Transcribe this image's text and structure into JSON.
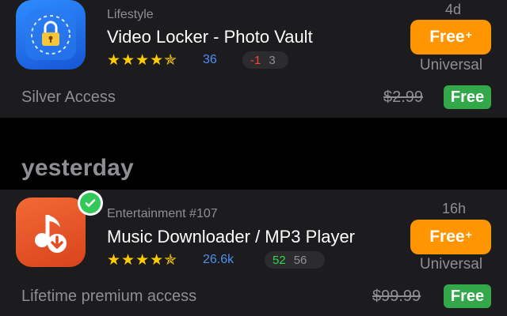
{
  "apps": [
    {
      "category": "Lifestyle",
      "title": "Video Locker - Photo Vault",
      "stars": "★★★★✯",
      "rating_count": "36",
      "rank_change": "-1",
      "rank": "3",
      "time_ago": "4d",
      "button_label": "Free",
      "button_plus": "+",
      "platform": "Universal",
      "access": "Silver Access",
      "old_price": "$2.99",
      "price": "Free",
      "icon": "lock-vault-icon",
      "icon_color": "#2f8cff"
    },
    {
      "category": "Entertainment #107",
      "title": "Music Downloader / MP3 Player",
      "stars": "★★★★✯",
      "rating_count": "26.6k",
      "rank_change": "52",
      "rank": "56",
      "time_ago": "16h",
      "button_label": "Free",
      "button_plus": "+",
      "platform": "Universal",
      "access": "Lifetime premium access",
      "old_price": "$99.99",
      "price": "Free",
      "icon": "music-download-icon",
      "icon_color": "#f26a35",
      "verified": "check-icon"
    }
  ],
  "section_header": "yesterday",
  "colors": {
    "accent_orange": "#ff9500",
    "free_green": "#32a84b",
    "star_yellow": "#ffcc00",
    "link_blue": "#4f8ff5"
  }
}
